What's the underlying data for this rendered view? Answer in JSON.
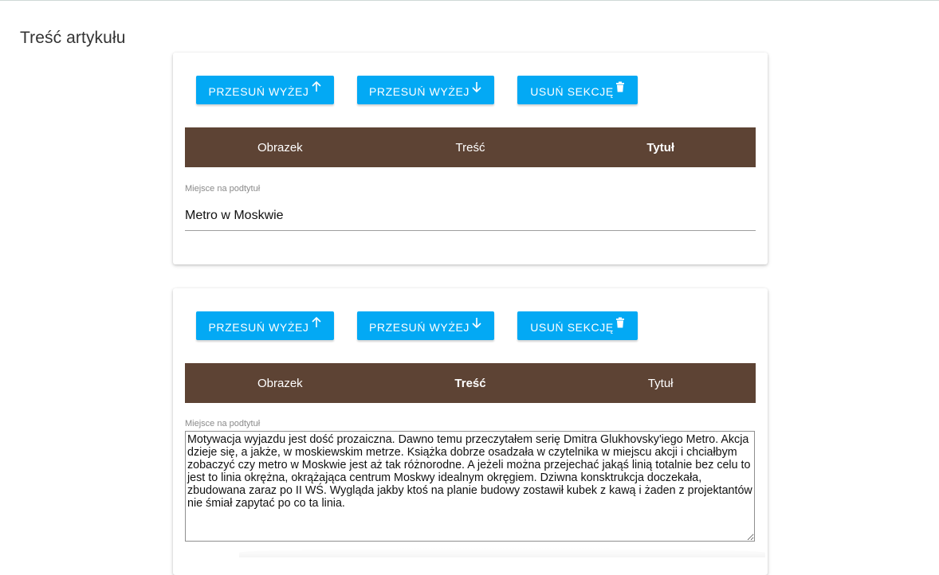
{
  "page": {
    "title": "Treść artykułu"
  },
  "colors": {
    "accent": "#03a9f4",
    "tab_bar": "#5d4334"
  },
  "sections": [
    {
      "buttons": {
        "move_up": "PRZESUŃ WYŻEJ",
        "move_down": "PRZESUŃ WYŻEJ",
        "delete": "USUŃ SEKCJĘ"
      },
      "tabs": [
        "Obrazek",
        "Treść",
        "Tytuł"
      ],
      "active_tab": "Tytuł",
      "field_label": "Miejsce na podtytuł",
      "field_value": "Metro w Moskwie"
    },
    {
      "buttons": {
        "move_up": "PRZESUŃ WYŻEJ",
        "move_down": "PRZESUŃ WYŻEJ",
        "delete": "USUŃ SEKCJĘ"
      },
      "tabs": [
        "Obrazek",
        "Treść",
        "Tytuł"
      ],
      "active_tab": "Treść",
      "field_label": "Miejsce na podtytuł",
      "field_value": "Motywacja wyjazdu jest dość prozaiczna. Dawno temu przeczytałem serię Dmitra Glukhovsky'iego Metro. Akcja dzieje się, a jakże, w moskiewskim metrze. Książka dobrze osadzała w czytelnika w miejscu akcji i chciałbym zobaczyć czy metro w Moskwie jest aż tak różnorodne. A jeżeli można przejechać jakąś linią totalnie bez celu to jest to linia okrężna, okrążająca centrum Moskwy idealnym okręgiem. Dziwna konsktrukcja doczekała, zbudowana zaraz po II WŚ. Wygląda jakby ktoś na planie budowy zostawił kubek z kawą i żaden z projektantów nie śmiał zapytać po co ta linia."
    }
  ]
}
